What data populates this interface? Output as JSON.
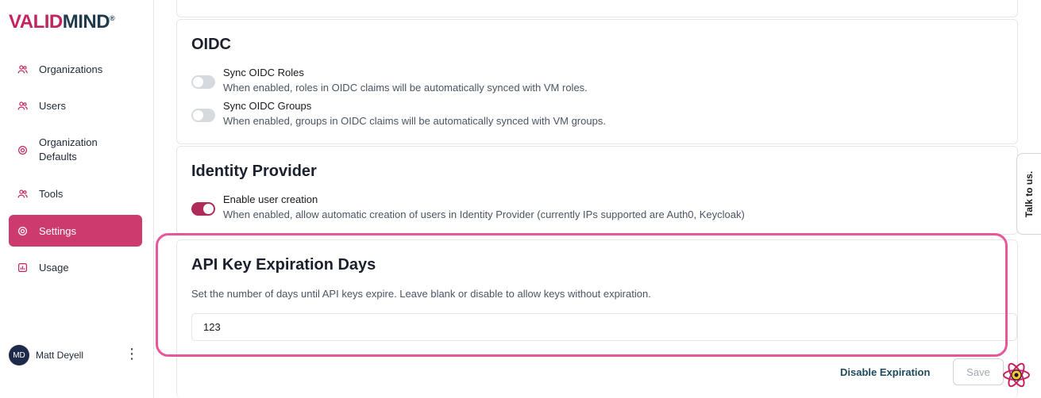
{
  "brand": {
    "logo_v": "V",
    "logo_alid": "ALID",
    "logo_mind": "MIND",
    "logo_reg": "®"
  },
  "sidebar": {
    "items": [
      {
        "label": "Organizations",
        "icon": "users-icon"
      },
      {
        "label": "Users",
        "icon": "users-icon"
      },
      {
        "label": "Organization Defaults",
        "icon": "settings-icon"
      },
      {
        "label": "Tools",
        "icon": "users-icon"
      },
      {
        "label": "Settings",
        "icon": "settings-icon",
        "active": true
      },
      {
        "label": "Usage",
        "icon": "chart-icon"
      }
    ],
    "user": {
      "initials": "MD",
      "name": "Matt Deyell"
    }
  },
  "oidc": {
    "title": "OIDC",
    "options": [
      {
        "title": "Sync OIDC Roles",
        "desc": "When enabled, roles in OIDC claims will be automatically synced with VM roles.",
        "enabled": false
      },
      {
        "title": "Sync OIDC Groups",
        "desc": "When enabled, groups in OIDC claims will be automatically synced with VM groups.",
        "enabled": false
      }
    ]
  },
  "identity": {
    "title": "Identity Provider",
    "options": [
      {
        "title": "Enable user creation",
        "desc": "When enabled, allow automatic creation of users in Identity Provider (currently IPs supported are Auth0, Keycloak)",
        "enabled": true
      }
    ]
  },
  "api_key": {
    "title": "API Key Expiration Days",
    "desc": "Set the number of days until API keys expire. Leave blank or disable to allow keys without expiration.",
    "value": "123"
  },
  "actions": {
    "disable_label": "Disable Expiration",
    "save_label": "Save"
  },
  "feedback_tab": {
    "label": "Talk to us."
  },
  "colors": {
    "accent": "#c3245f",
    "active_nav": "#cc3a6e",
    "highlight": "#e9559a",
    "toggle_on": "#b02a5a"
  }
}
